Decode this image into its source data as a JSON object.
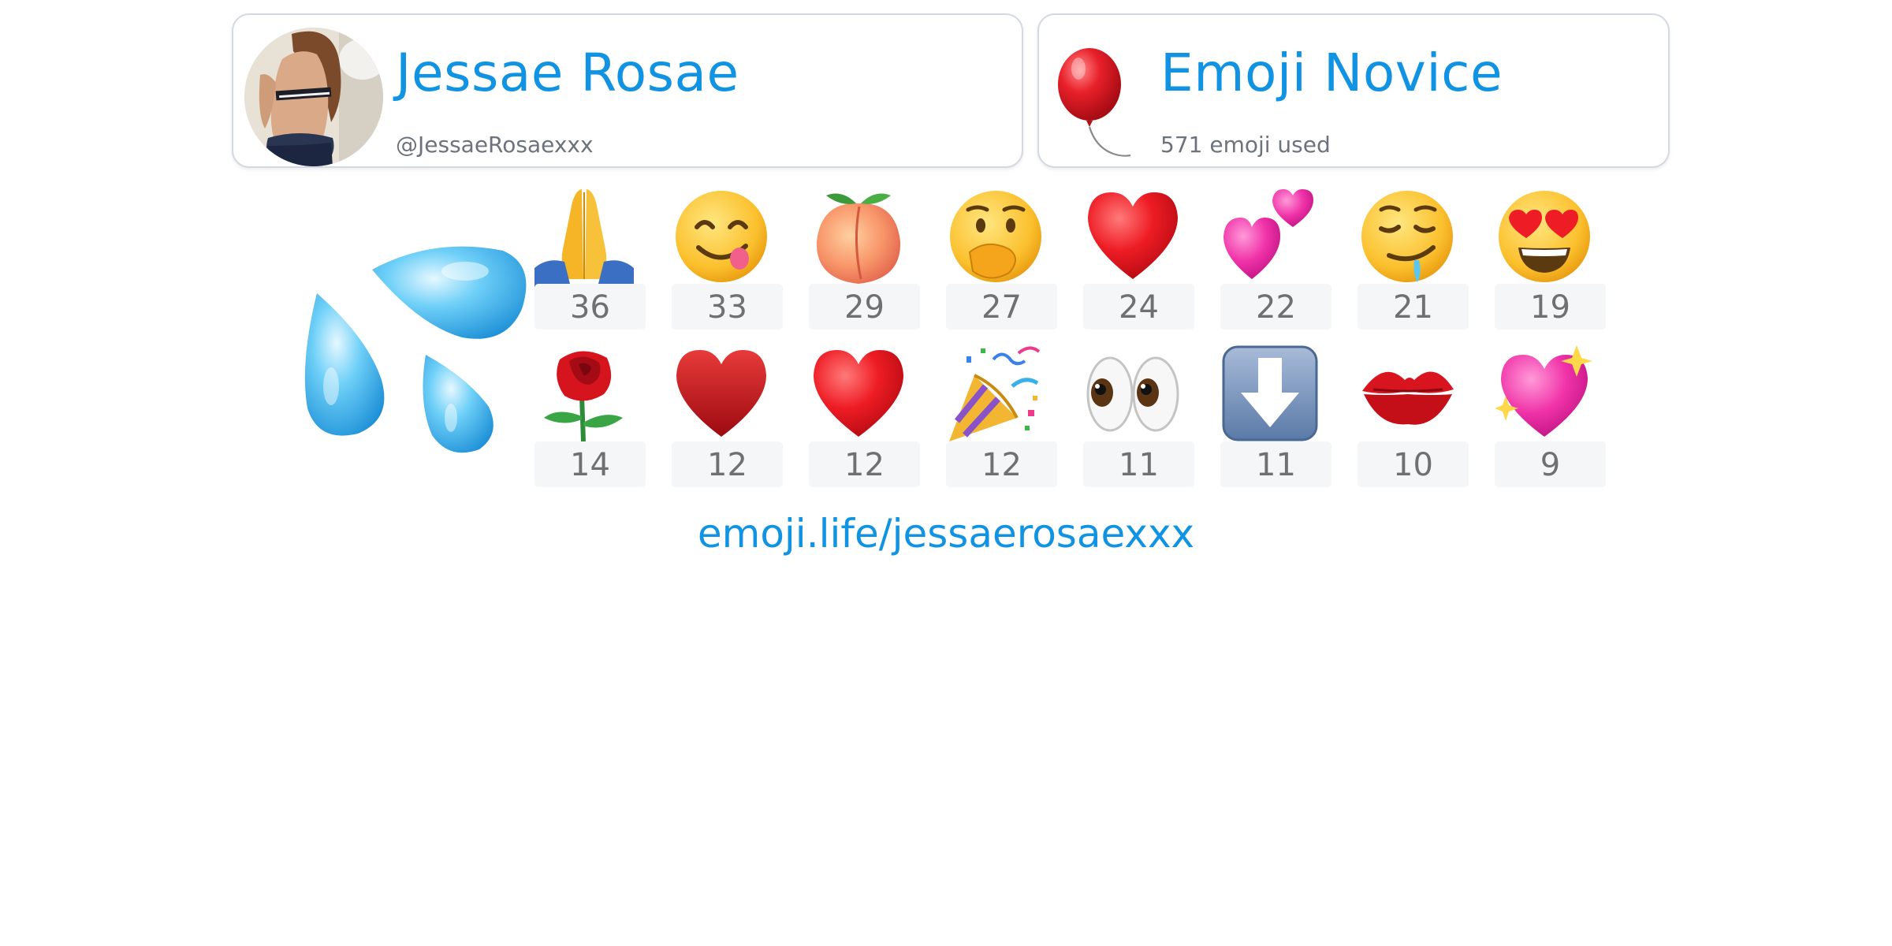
{
  "profile": {
    "name": "Jessae Rosae",
    "handle": "@JessaeRosaexxx",
    "avatar": "profile-photo"
  },
  "rank": {
    "title": "Emoji Novice",
    "subtitle": "571 emoji used",
    "icon": "balloon"
  },
  "hero_emoji": "sweat-droplets",
  "emoji_stats": [
    {
      "emoji": "🙏",
      "icon": "folded-hands",
      "count": "36"
    },
    {
      "emoji": "😋",
      "icon": "yum-face",
      "count": "33"
    },
    {
      "emoji": "🍑",
      "icon": "peach",
      "count": "29"
    },
    {
      "emoji": "🤭",
      "icon": "hand-over-mouth-face",
      "count": "27"
    },
    {
      "emoji": "❤️",
      "icon": "red-heart",
      "count": "24"
    },
    {
      "emoji": "💕",
      "icon": "two-hearts",
      "count": "22"
    },
    {
      "emoji": "🤤",
      "icon": "drooling-face",
      "count": "21"
    },
    {
      "emoji": "😍",
      "icon": "heart-eyes-face",
      "count": "19"
    },
    {
      "emoji": "🌹",
      "icon": "rose",
      "count": "14"
    },
    {
      "emoji": "♥️",
      "icon": "heart-suit",
      "count": "12"
    },
    {
      "emoji": "❤️",
      "icon": "red-heart",
      "count": "12"
    },
    {
      "emoji": "🎉",
      "icon": "party-popper",
      "count": "12"
    },
    {
      "emoji": "👀",
      "icon": "eyes",
      "count": "11"
    },
    {
      "emoji": "⬇️",
      "icon": "down-arrow",
      "count": "11"
    },
    {
      "emoji": "💋",
      "icon": "kiss-mark",
      "count": "10"
    },
    {
      "emoji": "💖",
      "icon": "sparkling-heart",
      "count": "9"
    }
  ],
  "link": "emoji.life/jessaerosaexxx",
  "colors": {
    "accent": "#1193e3",
    "count_text": "#707070",
    "count_bg": "#f5f6f7",
    "card_border": "#d3d8e2"
  }
}
